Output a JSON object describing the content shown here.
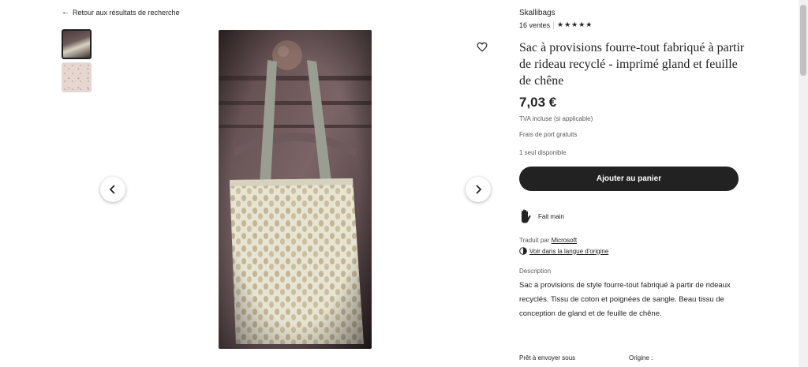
{
  "nav": {
    "back_label": "Retour aux résultats de recherche"
  },
  "gallery": {
    "thumbnails": [
      "photo-1",
      "photo-2"
    ],
    "prev_icon": "chevron-left-icon",
    "next_icon": "chevron-right-icon",
    "favorite_icon": "heart-icon"
  },
  "shop": {
    "name": "Skallibags",
    "sales": "16 ventes",
    "rating_stars": "★★★★★",
    "rating_value": 5
  },
  "product": {
    "title": "Sac à provisions fourre-tout fabriqué à partir de rideau recyclé - imprimé gland et feuille de chêne",
    "price": "7,03 €",
    "vat": "TVA incluse (si applicable)",
    "shipping": "Frais de port gratuits",
    "stock": "1 seul disponible"
  },
  "actions": {
    "add_to_cart": "Ajouter au panier"
  },
  "highlights": {
    "handmade": "Fait main",
    "handmade_icon": "hand-icon"
  },
  "translation": {
    "translated_by": "Traduit par",
    "provider": "Microsoft",
    "view_original": "Voir dans la langue d'origine",
    "globe_icon": "globe-icon"
  },
  "description": {
    "label": "Description",
    "text": "Sac à provisions de style fourre-tout fabriqué à partir de rideaux recyclés. Tissu de coton et poignées de sangle. Beau tissu de conception de gland et de feuille de chêne."
  },
  "details": {
    "ready_label": "Prêt à envoyer sous",
    "origin_label": "Origine :"
  },
  "colors": {
    "button": "#222222",
    "text": "#222222",
    "muted": "#595959"
  }
}
